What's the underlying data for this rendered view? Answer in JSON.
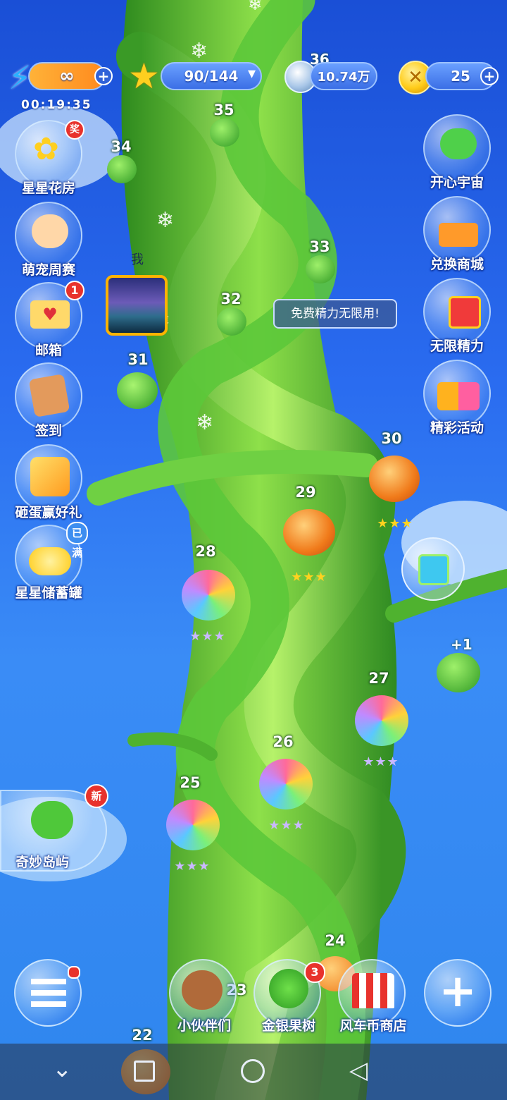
{
  "top_bar": {
    "energy": {
      "value": "∞",
      "plus": "+"
    },
    "stars": {
      "value": "90/144",
      "dropdown": "▾"
    },
    "silver": {
      "value": "10.74万"
    },
    "gold": {
      "value": "25",
      "plus": "+"
    },
    "timer": "00:19:35",
    "hidden_level": "36"
  },
  "left_menu": [
    {
      "id": "flower-house",
      "label": "星星花房",
      "badge": "奖"
    },
    {
      "id": "pet-week",
      "label": "萌宠周赛",
      "badge": ""
    },
    {
      "id": "mailbox",
      "label": "邮箱",
      "badge": "1"
    },
    {
      "id": "sign-in",
      "label": "签到",
      "badge": ""
    },
    {
      "id": "egg-gift",
      "label": "砸蛋赢好礼",
      "badge": ""
    },
    {
      "id": "star-piggy",
      "label": "星星储蓄罐",
      "badge": "已满"
    }
  ],
  "right_menu": [
    {
      "id": "happy-universe",
      "label": "开心宇宙"
    },
    {
      "id": "exchange-mall",
      "label": "兑换商城"
    },
    {
      "id": "unlimited-energy",
      "label": "无限精力"
    },
    {
      "id": "events",
      "label": "精彩活动"
    }
  ],
  "tooltip": "免费精力无限用!",
  "player_marker": "我",
  "levels": [
    {
      "n": "35"
    },
    {
      "n": "34"
    },
    {
      "n": "33"
    },
    {
      "n": "32"
    },
    {
      "n": "31"
    },
    {
      "n": "30",
      "stars": 3
    },
    {
      "n": "29",
      "stars": 3
    },
    {
      "n": "28",
      "stars": 3
    },
    {
      "n": "27",
      "stars": 3
    },
    {
      "n": "26",
      "stars": 3
    },
    {
      "n": "25",
      "stars": 3
    },
    {
      "n": "24"
    },
    {
      "n": "23"
    },
    {
      "n": "22"
    }
  ],
  "bonus_label": "+1",
  "island": {
    "label": "奇妙岛屿",
    "badge": "新"
  },
  "bottom_bar": {
    "partners": "小伙伴们",
    "fruit_tree": "金银果树",
    "fruit_tree_badge": "3",
    "shop": "风车币商店",
    "add": "+"
  },
  "colors": {
    "star_gold": "#ffd21f",
    "star_rainbow": "#b9a8ff",
    "badge_red": "#e8322c"
  }
}
